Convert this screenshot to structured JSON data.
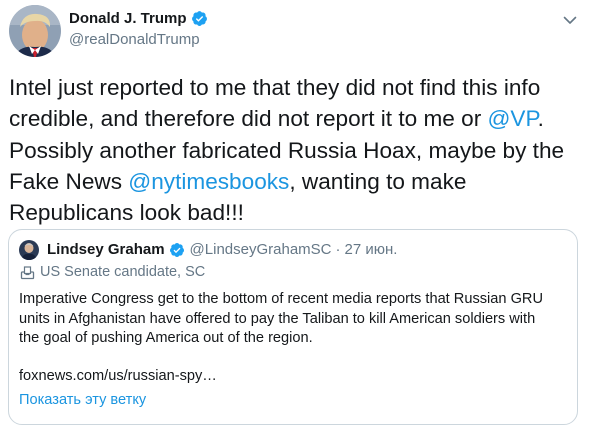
{
  "author": {
    "name": "Donald J. Trump",
    "handle": "@realDonaldTrump",
    "avatar_icon": "user-avatar",
    "verified_icon": "verified-badge-icon"
  },
  "tweet": {
    "text_parts": [
      "Intel just reported to me that they did not find this info\ncredible, and therefore did not report it to me or ",
      "@VP",
      ".\nPossibly another fabricated Russia Hoax, maybe by the\nFake News ",
      "@nytimesbooks",
      ", wanting to make\nRepublicans look bad!!!"
    ]
  },
  "quoted_tweet": {
    "name": "Lindsey Graham",
    "handle": "@LindseyGrahamSC",
    "separator": "·",
    "date": "27 июн.",
    "label": "US Senate candidate, SC",
    "body": "Imperative Congress get to the bottom of recent media reports that Russian GRU\nunits in Afghanistan have offered to pay the Taliban to kill American soldiers with\nthe goal of pushing America out of the region.",
    "link_text": "foxnews.com/us/russian-spy…",
    "show_thread": "Показать эту ветку"
  },
  "colors": {
    "link": "#1b95e0",
    "verified": "#1da1f2",
    "secondary_text": "#657786",
    "border": "#ccd6dd"
  }
}
